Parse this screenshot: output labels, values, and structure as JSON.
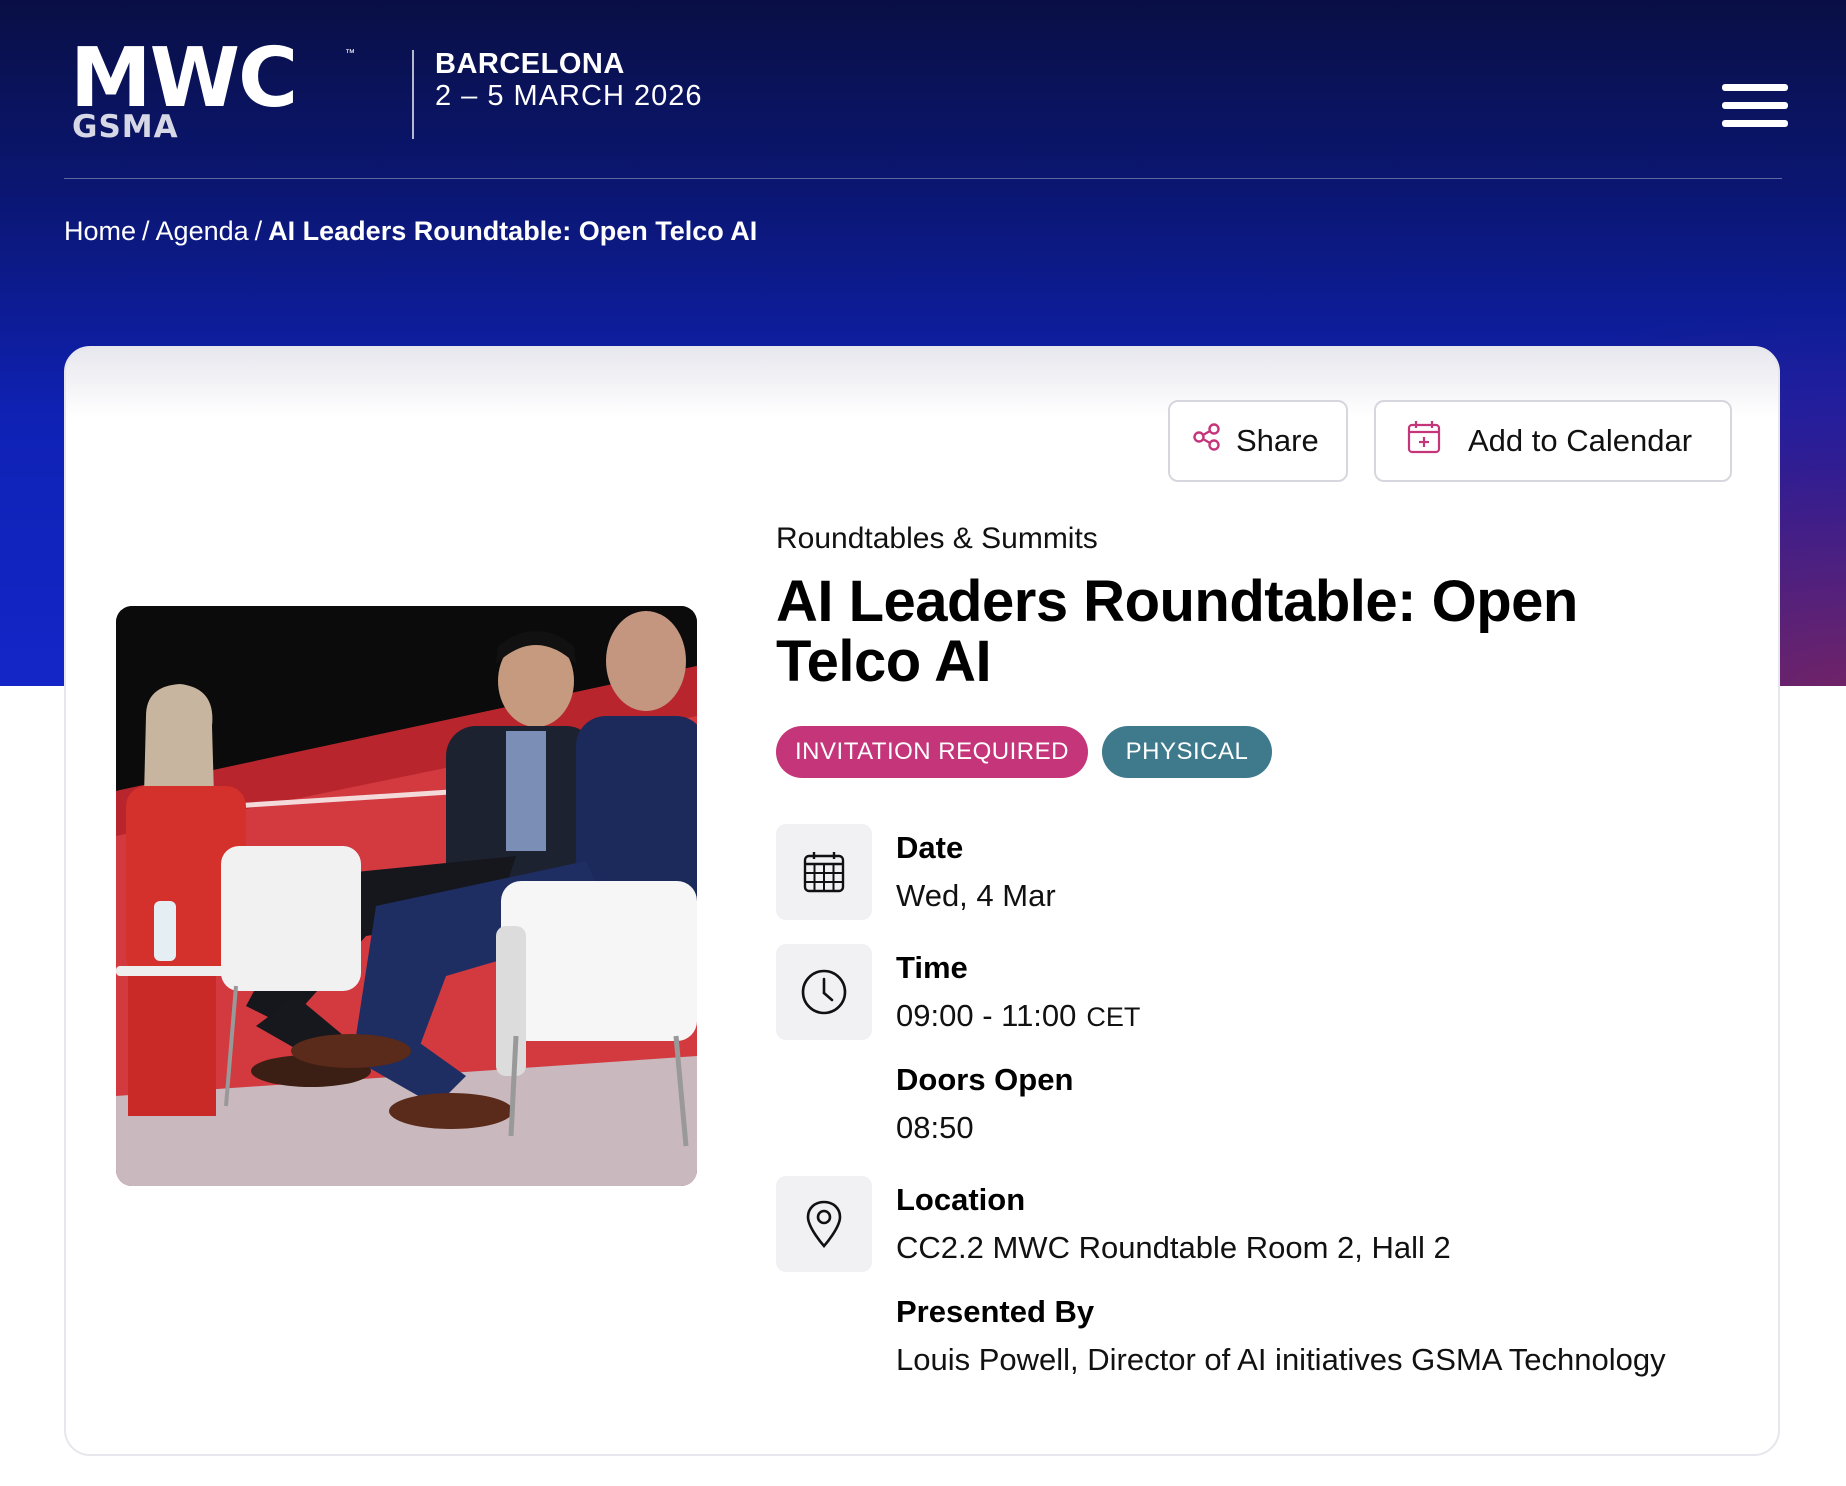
{
  "header": {
    "logo_text": "MWC",
    "logo_sub": "GSMA",
    "logo_tm": "™",
    "event_city": "BARCELONA",
    "event_dates": "2 – 5 MARCH 2026",
    "menu_icon": "hamburger-menu-icon"
  },
  "breadcrumb": {
    "items": [
      "Home",
      "Agenda"
    ],
    "separator": "/",
    "current": "AI Leaders Roundtable: Open Telco AI"
  },
  "actions": {
    "share_label": "Share",
    "share_icon": "share-icon",
    "calendar_label": "Add to Calendar",
    "calendar_icon": "calendar-add-icon"
  },
  "session": {
    "category": "Roundtables & Summits",
    "title": "AI Leaders Roundtable: Open Telco AI",
    "tags": [
      {
        "label": "INVITATION REQUIRED",
        "color": "#c4357a"
      },
      {
        "label": "PHYSICAL",
        "color": "#3e7a8c"
      }
    ],
    "date_label": "Date",
    "date_value": "Wed, 4 Mar",
    "time_label": "Time",
    "time_value": "09:00 - 11:00",
    "time_zone": "CET",
    "doors_label": "Doors Open",
    "doors_value": "08:50",
    "location_label": "Location",
    "location_value": "CC2.2 MWC Roundtable Room 2, Hall 2",
    "presented_label": "Presented By",
    "presented_value": "Louis Powell, Director of AI initiatives GSMA Technology"
  },
  "colors": {
    "accent_pink": "#c4357a",
    "accent_teal": "#3e7a8c",
    "hero_dark": "#090f45",
    "hero_blue": "#1426c7"
  }
}
